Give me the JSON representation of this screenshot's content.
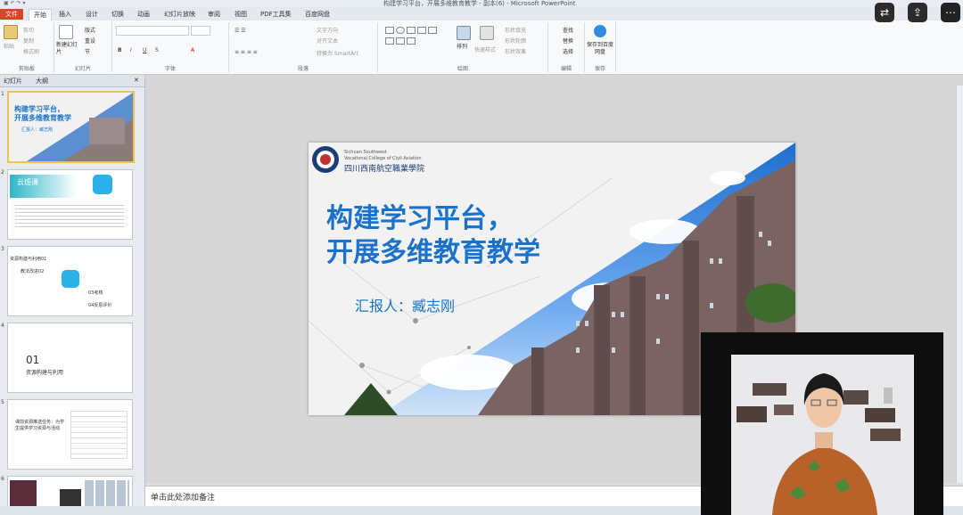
{
  "window": {
    "title": "构建学习平台，开展多维教育教学 - 副本(6) - Microsoft PowerPoint"
  },
  "ribbon_tabs": [
    "文件",
    "开始",
    "插入",
    "设计",
    "切换",
    "动画",
    "幻灯片放映",
    "审阅",
    "视图",
    "PDF工具集",
    "百度网盘"
  ],
  "active_tab": "开始",
  "ribbon": {
    "clipboard": {
      "paste": "粘贴",
      "cut": "剪切",
      "copy": "复制",
      "format_painter": "格式刷",
      "label": "剪贴板"
    },
    "slides": {
      "new_slide": "新建幻灯片",
      "layout": "版式",
      "reset": "重设",
      "section": "节",
      "label": "幻灯片"
    },
    "font": {
      "label": "字体"
    },
    "paragraph": {
      "text_direction": "文字方向",
      "align_text": "对齐文本",
      "smartart": "转换为 SmartArt",
      "label": "段落"
    },
    "drawing": {
      "arrange": "排列",
      "quick_styles": "快速样式",
      "fill": "形状填充",
      "outline": "形状轮廓",
      "effects": "形状效果",
      "label": "绘图"
    },
    "editing": {
      "find": "查找",
      "replace": "替换",
      "select": "选择",
      "label": "编辑"
    },
    "save": {
      "save_baidu": "保存到百度网盘",
      "label": "保存"
    }
  },
  "slide_pane": {
    "tabs": [
      "幻灯片",
      "大纲"
    ],
    "thumbs": [
      {
        "num": "1",
        "title": "构建学习平台，\n开展多维教育教学",
        "sub": "汇报人：臧志刚"
      },
      {
        "num": "2",
        "title": "云班课"
      },
      {
        "num": "3",
        "items": [
          "资源构建与利用01",
          "教法改进02",
          "03考核",
          "04反思评价"
        ]
      },
      {
        "num": "4",
        "big": "01",
        "sub": "资源构建与利用"
      },
      {
        "num": "5",
        "text": "课前资源推送任务：为学生提供学习资源与活动"
      },
      {
        "num": "6"
      }
    ]
  },
  "slide": {
    "school_en_1": "Sichuan Southwest",
    "school_en_2": "Vocational College of Civil Aviation",
    "school_cn": "四川西南航空職業學院",
    "title_line1": "构建学习平台，",
    "title_line2": "开展多维教育教学",
    "presenter": "汇报人：臧志刚"
  },
  "notes": {
    "placeholder": "单击此处添加备注"
  },
  "colors": {
    "accent": "#1b72c8",
    "file_tab": "#d24726",
    "selected_thumb": "#f1c24b"
  },
  "meeting_controls": [
    "swap-icon",
    "share-icon",
    "more-icon"
  ]
}
